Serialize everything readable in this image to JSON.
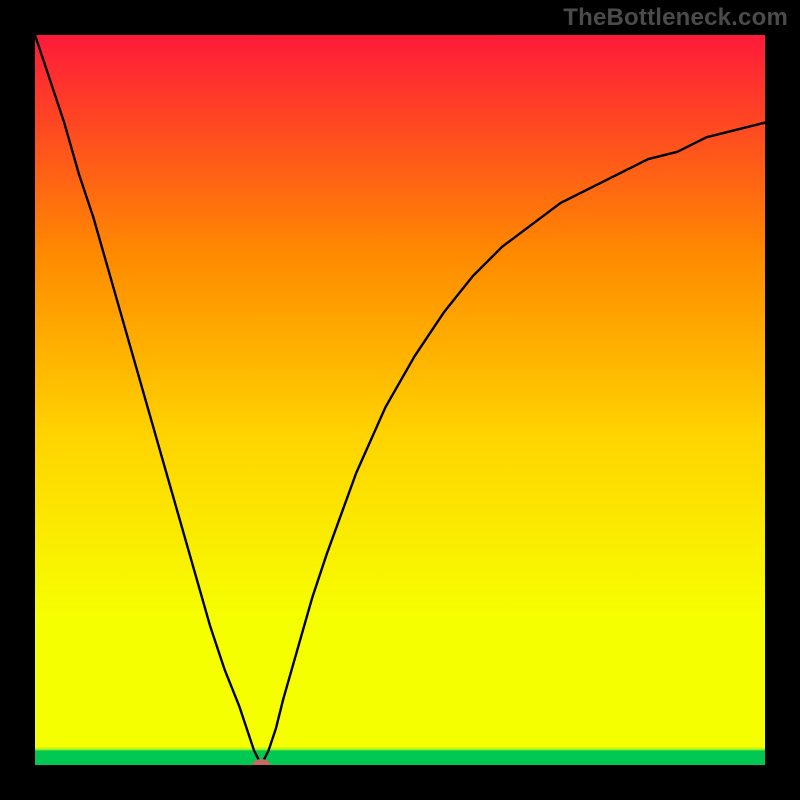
{
  "watermark": "TheBottleneck.com",
  "chart_data": {
    "type": "line",
    "title": "",
    "xlabel": "",
    "ylabel": "",
    "xlim": [
      0,
      100
    ],
    "ylim": [
      0,
      100
    ],
    "gradient_colors": {
      "top": "#ff1a3a",
      "mid_upper": "#ff8a00",
      "mid": "#ffd400",
      "mid_lower": "#f6ff00",
      "green_band": "#00e060",
      "bottom": "#00c853"
    },
    "green_band_fraction": 0.02,
    "curve_min": {
      "x": 31,
      "y": 0
    },
    "marker": {
      "x": 31,
      "y": 0,
      "color": "#c56a63"
    },
    "series": [
      {
        "name": "bottleneck-curve",
        "x": [
          0,
          2,
          4,
          6,
          8,
          10,
          12,
          14,
          16,
          18,
          20,
          22,
          24,
          26,
          28,
          29,
          30,
          31,
          32,
          33,
          34,
          36,
          38,
          40,
          44,
          48,
          52,
          56,
          60,
          64,
          68,
          72,
          76,
          80,
          84,
          88,
          92,
          96,
          100
        ],
        "y": [
          100,
          94,
          88,
          81,
          75,
          68,
          61,
          54,
          47,
          40,
          33,
          26,
          19,
          13,
          8,
          5,
          2,
          0,
          2,
          5,
          9,
          16,
          23,
          29,
          40,
          49,
          56,
          62,
          67,
          71,
          74,
          77,
          79,
          81,
          83,
          84,
          86,
          87,
          88
        ]
      }
    ]
  }
}
